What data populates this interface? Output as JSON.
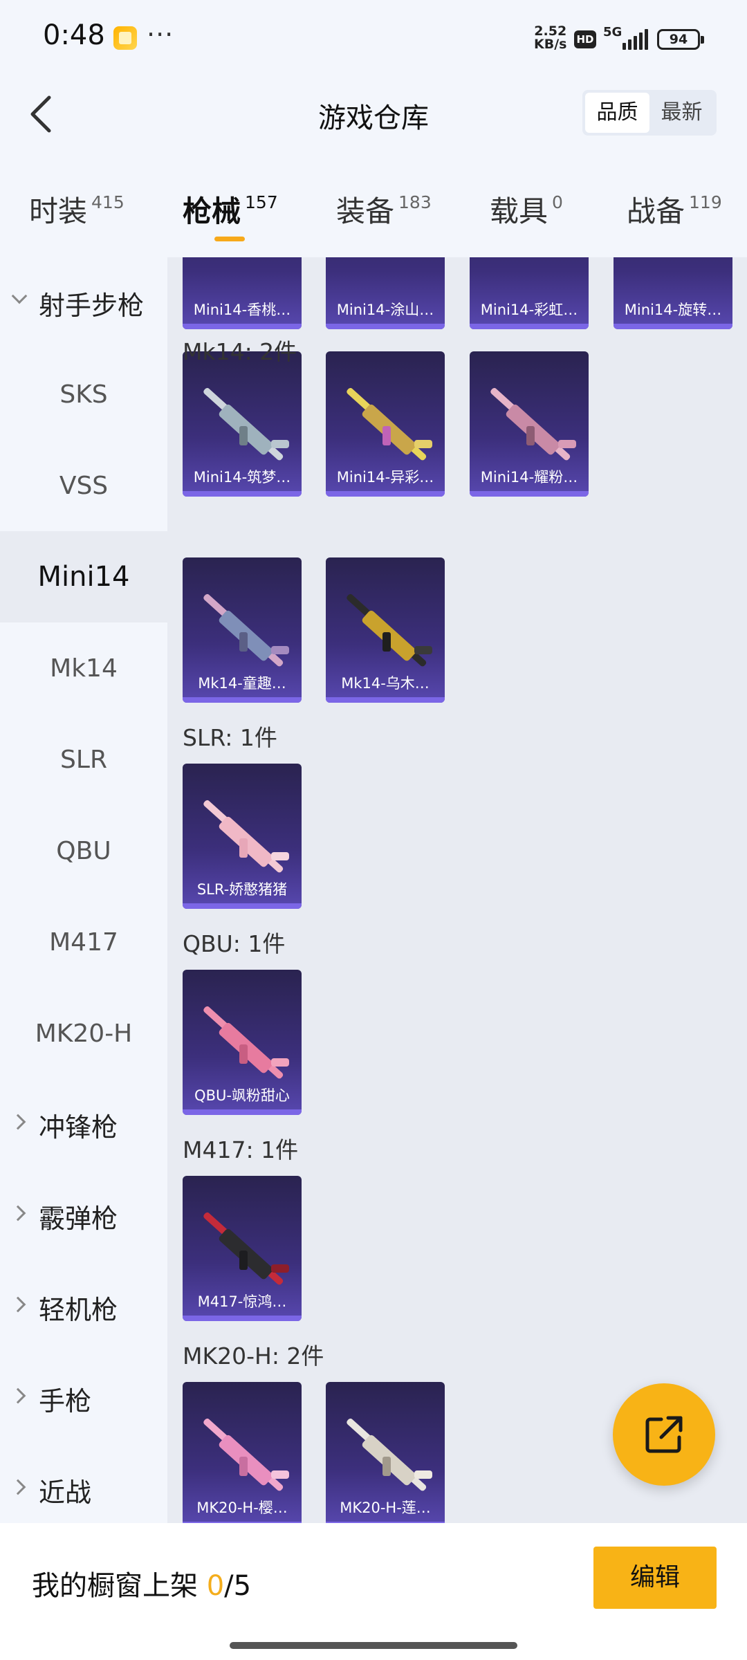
{
  "status_bar": {
    "time": "0:48",
    "more": "···",
    "speed_value": "2.52",
    "speed_unit": "KB/s",
    "hd": "HD",
    "network": "5G",
    "battery": "94"
  },
  "header": {
    "title": "游戏仓库",
    "sort_options": [
      "品质",
      "最新"
    ],
    "sort_selected": "品质"
  },
  "tabs": [
    {
      "label": "时装",
      "count": "415"
    },
    {
      "label": "枪械",
      "count": "157"
    },
    {
      "label": "装备",
      "count": "183"
    },
    {
      "label": "载具",
      "count": "0"
    },
    {
      "label": "战备",
      "count": "119"
    }
  ],
  "sidebar": {
    "items": [
      {
        "label": "射手步枪",
        "type": "group-expanded"
      },
      {
        "label": "SKS",
        "type": "sub"
      },
      {
        "label": "VSS",
        "type": "sub"
      },
      {
        "label": "Mini14",
        "type": "sub-active"
      },
      {
        "label": "Mk14",
        "type": "sub"
      },
      {
        "label": "SLR",
        "type": "sub"
      },
      {
        "label": "QBU",
        "type": "sub"
      },
      {
        "label": "M417",
        "type": "sub"
      },
      {
        "label": "MK20-H",
        "type": "sub"
      },
      {
        "label": "冲锋枪",
        "type": "group"
      },
      {
        "label": "霰弹枪",
        "type": "group"
      },
      {
        "label": "轻机枪",
        "type": "group"
      },
      {
        "label": "手枪",
        "type": "group"
      },
      {
        "label": "近战",
        "type": "group"
      }
    ]
  },
  "content": {
    "top_row": [
      "Mini14-香桃…",
      "Mini14-涂山…",
      "Mini14-彩虹…",
      "Mini14-旋转…"
    ],
    "mini14_row2": [
      "Mini14-筑梦…",
      "Mini14-异彩…",
      "Mini14-耀粉…"
    ],
    "sections": [
      {
        "title": "Mk14: 2件",
        "items": [
          "Mk14-童趣…",
          "Mk14-乌木…"
        ]
      },
      {
        "title": "SLR: 1件",
        "items": [
          "SLR-娇憨猪猪"
        ]
      },
      {
        "title": "QBU: 1件",
        "items": [
          "QBU-飒粉甜心"
        ]
      },
      {
        "title": "M417: 1件",
        "items": [
          "M417-惊鸿…"
        ]
      },
      {
        "title": "MK20-H: 2件",
        "items": [
          "MK20-H-樱…",
          "MK20-H-莲…"
        ]
      }
    ]
  },
  "bottom_bar": {
    "label": "我的橱窗上架",
    "current": "0",
    "total": "/5",
    "edit_label": "编辑"
  },
  "colors": {
    "accent": "#f8b316",
    "card_top": "#2a2350",
    "card_bottom": "#5848b0"
  }
}
